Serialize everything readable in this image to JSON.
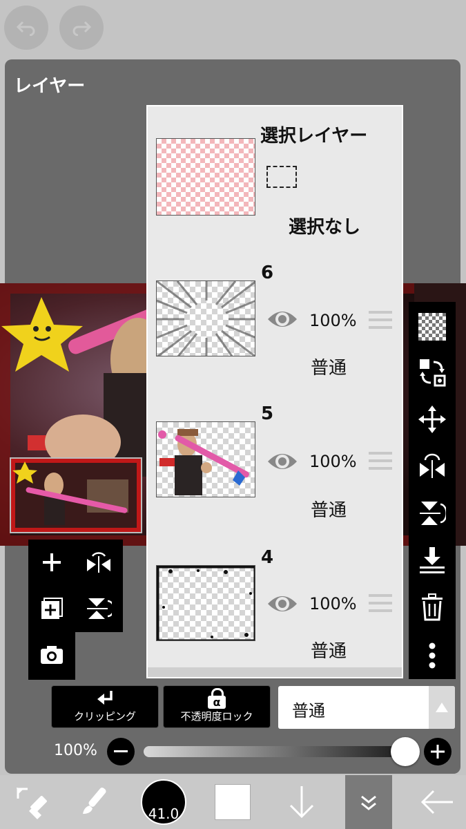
{
  "top": {
    "undo_icon": "undo-icon",
    "redo_icon": "redo-icon"
  },
  "panel": {
    "title": "レイヤー"
  },
  "selection_layer": {
    "name": "選択レイヤー",
    "status": "選択なし"
  },
  "layers": [
    {
      "name": "6",
      "opacity": "100%",
      "blend": "普通",
      "visible": true
    },
    {
      "name": "5",
      "opacity": "100%",
      "blend": "普通",
      "visible": true
    },
    {
      "name": "4",
      "opacity": "100%",
      "blend": "普通",
      "visible": true
    }
  ],
  "right_toolbar": [
    "transparency-icon",
    "layer-transfer-icon",
    "move-icon",
    "flip-horizontal-icon",
    "flip-vertical-icon",
    "merge-down-icon",
    "delete-icon",
    "more-icon"
  ],
  "left_toolbar": [
    "add-layer-icon",
    "flip-horizontal-icon",
    "add-special-layer-icon",
    "flip-vertical-icon",
    "camera-icon"
  ],
  "controls": {
    "clipping_label": "クリッピング",
    "alpha_lock_label": "不透明度ロック",
    "alpha_symbol": "α",
    "blend_mode": "普通",
    "opacity_label": "100%",
    "opacity_value": 1.0
  },
  "bottom_bar": {
    "brush_size": "41.0"
  },
  "colors": {
    "panel": "#6a6a6a",
    "background": "#c4c4c4",
    "list": "#e9e9e9",
    "toolbar": "#000000"
  }
}
